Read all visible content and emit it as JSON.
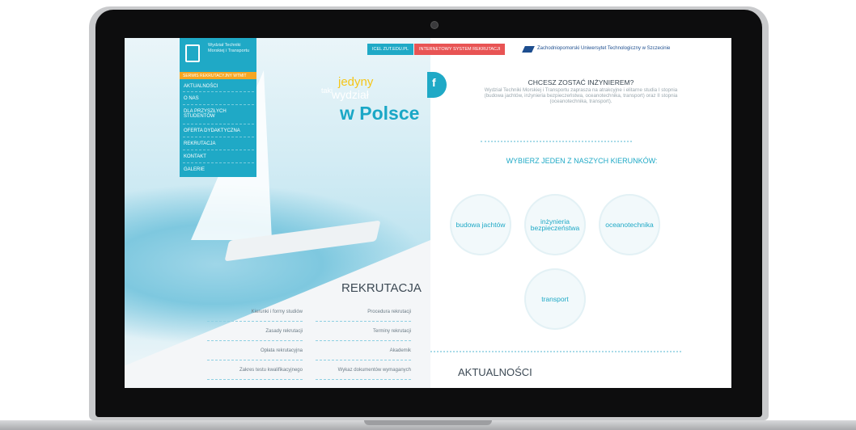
{
  "logo_text": "Wydział Techniki Morskiej i Transportu",
  "top_buttons": [
    {
      "label": "ICEL ZUT.EDU.PL",
      "color": "#1fa9c6"
    },
    {
      "label": "INTERNETOWY SYSTEM REKRUTACJI",
      "color": "#e85454"
    }
  ],
  "university": "Zachodniopomorski Uniwersytet Technologiczny w Szczecinie",
  "menu": {
    "highlight": "SERWIS REKRUTACYJNY WTMIT",
    "items": [
      "AKTUALNOŚCI",
      "O NAS",
      "DLA PRZYSZŁYCH STUDENTÓW",
      "OFERTA DYDAKTYCZNA",
      "REKRUTACJA",
      "KONTAKT",
      "GALERIE"
    ]
  },
  "tagline": {
    "small": "taki",
    "accent": "jedyny",
    "mid": "wydział",
    "big": "w Polsce"
  },
  "recruitment": {
    "title": "REKRUTACJA",
    "left": [
      "Kierunki i formy studiów",
      "Zasady rekrutacji",
      "Opłata rekrutacyjna",
      "Zakres testu kwalifikacyjnego"
    ],
    "right": [
      "Procedura rekrutacji",
      "Terminy rekrutacji",
      "Akademik",
      "Wykaz dokumentów wymaganych"
    ]
  },
  "facebook": "f",
  "intro": {
    "heading": "CHCESZ ZOSTAĆ INŻYNIEREM?",
    "body": "Wydział Techniki Morskiej i Transportu zaprasza na atrakcyjne i elitarne studia I stopnia (budowa jachtów, inżynieria bezpieczeństwa, oceanotechnika, transport) oraz II stopnia (oceanotechnika, transport)."
  },
  "choose": "WYBIERZ JEDEN Z NASZYCH KIERUNKÓW:",
  "courses": [
    "budowa jachtów",
    "inżynieria bezpieczeństwa",
    "oceanotechnika",
    "transport"
  ],
  "news_title": "AKTUALNOŚCI"
}
